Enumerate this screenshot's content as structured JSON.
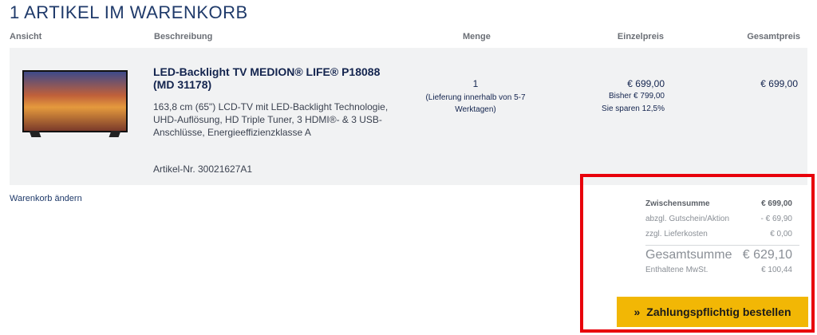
{
  "cart": {
    "title": "1 ARTIKEL IM WARENKORB"
  },
  "columns": {
    "ansicht": "Ansicht",
    "beschreibung": "Beschreibung",
    "menge": "Menge",
    "einzelpreis": "Einzelpreis",
    "gesamtpreis": "Gesamtpreis"
  },
  "item": {
    "name": "LED-Backlight TV MEDION® LIFE® P18088 (MD 31178)",
    "description": "163,8 cm (65\") LCD-TV mit LED-Backlight Technologie, UHD-Auflösung, HD Triple Tuner, 3 HDMI®- & 3 USB-Anschlüsse, Energieeffizienzklasse A",
    "article_no": "Artikel-Nr. 30021627A1",
    "quantity": "1",
    "delivery_note": "(Lieferung innerhalb von 5-7 Werktagen)",
    "unit_price": "€ 699,00",
    "previous_price": "Bisher € 799,00",
    "savings": "Sie sparen 12,5%",
    "total_price": "€ 699,00"
  },
  "actions": {
    "change_cart": "Warenkorb ändern"
  },
  "summary": {
    "subtotal_label": "Zwischensumme",
    "subtotal_value": "€ 699,00",
    "voucher_label": "abzgl. Gutschein/Aktion",
    "voucher_value": "- € 69,90",
    "shipping_label": "zzgl. Lieferkosten",
    "shipping_value": "€ 0,00",
    "grand_total_label": "Gesamtsumme",
    "grand_total_value": "€ 629,10",
    "vat_label": "Enthaltene MwSt.",
    "vat_value": "€ 100,44"
  },
  "order_button": {
    "label": "Zahlungspflichtig bestellen",
    "icon": "double-chevron-right-icon"
  },
  "colors": {
    "accent": "#f2b705",
    "highlight_frame": "#e8000b"
  }
}
